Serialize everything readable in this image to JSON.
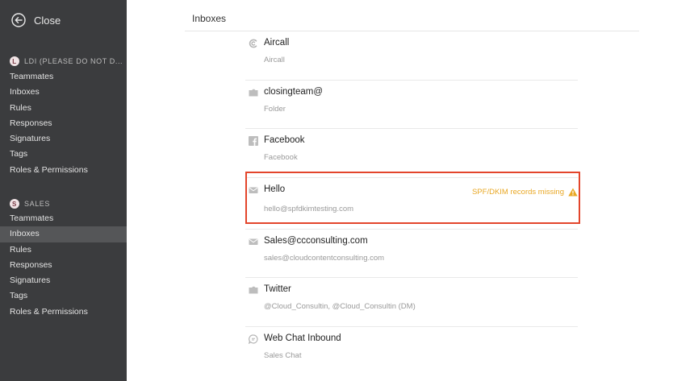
{
  "sidebar": {
    "close_label": "Close",
    "sections": [
      {
        "badge": "L",
        "title": "LDI (PLEASE DO NOT D...",
        "items": [
          "Teammates",
          "Inboxes",
          "Rules",
          "Responses",
          "Signatures",
          "Tags",
          "Roles & Permissions"
        ]
      },
      {
        "badge": "S",
        "title": "SALES",
        "items": [
          "Teammates",
          "Inboxes",
          "Rules",
          "Responses",
          "Signatures",
          "Tags",
          "Roles & Permissions"
        ],
        "active_item": "Inboxes"
      }
    ]
  },
  "main": {
    "title": "Inboxes",
    "inboxes": [
      {
        "name": "Aircall",
        "sub": "Aircall",
        "icon": "aircall-icon"
      },
      {
        "name": "closingteam@",
        "sub": "Folder",
        "icon": "folder-icon"
      },
      {
        "name": "Facebook",
        "sub": "Facebook",
        "icon": "facebook-icon"
      },
      {
        "name": "Hello",
        "sub": "hello@spfdkimtesting.com",
        "icon": "mail-icon",
        "warning": "SPF/DKIM records missing",
        "warning_icon": "warning-icon"
      },
      {
        "name": "Sales@ccconsulting.com",
        "sub": "sales@cloudcontentconsulting.com",
        "icon": "mail-icon"
      },
      {
        "name": "Twitter",
        "sub": "@Cloud_Consultin, @Cloud_Consultin (DM)",
        "icon": "folder-icon"
      },
      {
        "name": "Web Chat Inbound",
        "sub": "Sales Chat",
        "icon": "chat-icon"
      }
    ]
  },
  "colors": {
    "sidebar_bg": "#3b3c3e",
    "sidebar_active": "#555658",
    "warning": "#e9a825",
    "highlight_border": "#e3452b"
  }
}
